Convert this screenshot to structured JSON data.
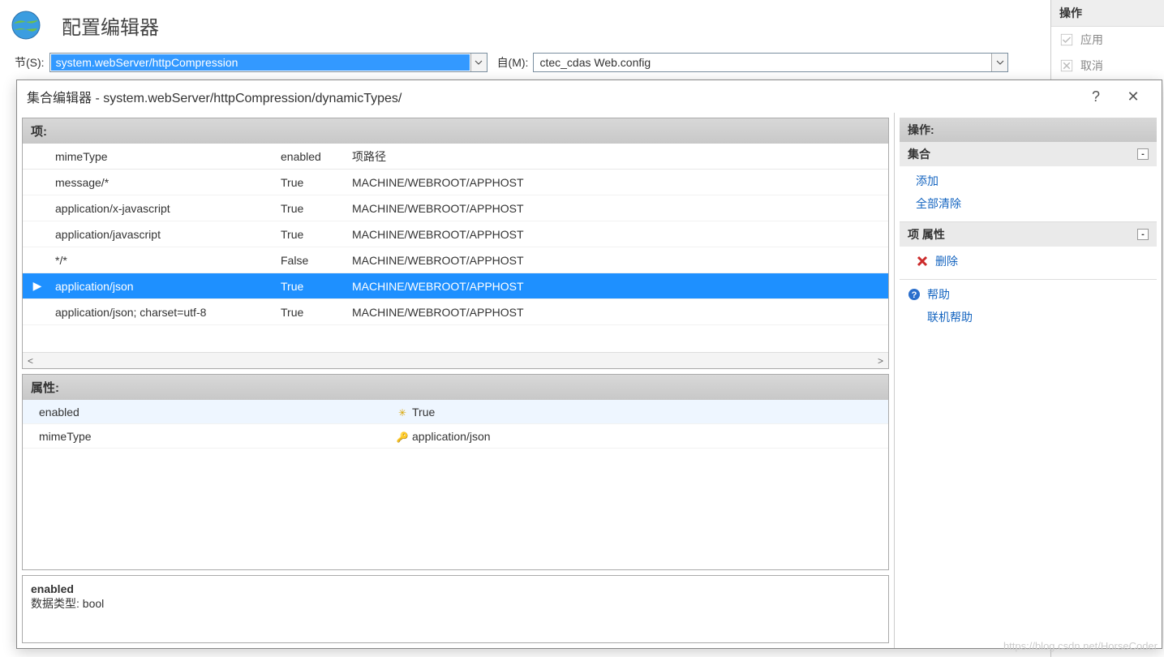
{
  "top": {
    "title": "配置编辑器",
    "section_label": "节(S):",
    "section_value": "system.webServer/httpCompression",
    "from_label": "自(M):",
    "from_value": "ctec_cdas Web.config"
  },
  "right_pane": {
    "header": "操作",
    "apply": "应用",
    "cancel": "取消"
  },
  "dialog": {
    "title": "集合编辑器 - system.webServer/httpCompression/dynamicTypes/",
    "help_glyph": "?",
    "close_glyph": "✕",
    "items_label": "项:",
    "columns": {
      "mime": "mimeType",
      "enabled": "enabled",
      "path": "项路径"
    },
    "rows": [
      {
        "mime": "message/*",
        "enabled": "True",
        "path": "MACHINE/WEBROOT/APPHOST",
        "selected": false
      },
      {
        "mime": "application/x-javascript",
        "enabled": "True",
        "path": "MACHINE/WEBROOT/APPHOST",
        "selected": false
      },
      {
        "mime": "application/javascript",
        "enabled": "True",
        "path": "MACHINE/WEBROOT/APPHOST",
        "selected": false
      },
      {
        "mime": "*/*",
        "enabled": "False",
        "path": "MACHINE/WEBROOT/APPHOST",
        "selected": false
      },
      {
        "mime": "application/json",
        "enabled": "True",
        "path": "MACHINE/WEBROOT/APPHOST",
        "selected": true
      },
      {
        "mime": "application/json; charset=utf-8",
        "enabled": "True",
        "path": "MACHINE/WEBROOT/APPHOST",
        "selected": false
      }
    ],
    "scroll_left": "<",
    "scroll_right": ">",
    "props_label": "属性:",
    "props": [
      {
        "key": "enabled",
        "marker": "star",
        "value": "True",
        "selected": true
      },
      {
        "key": "mimeType",
        "marker": "key",
        "value": "application/json",
        "selected": false
      }
    ],
    "desc": {
      "name": "enabled",
      "type_line": "数据类型: bool"
    },
    "actions": {
      "header": "操作:",
      "collection": "集合",
      "add": "添加",
      "clear_all": "全部清除",
      "item_props": "项 属性",
      "delete": "删除",
      "help": "帮助",
      "online_help": "联机帮助",
      "collapse_glyph": "-"
    }
  },
  "watermark": "https://blog.csdn.net/HorseCoder"
}
